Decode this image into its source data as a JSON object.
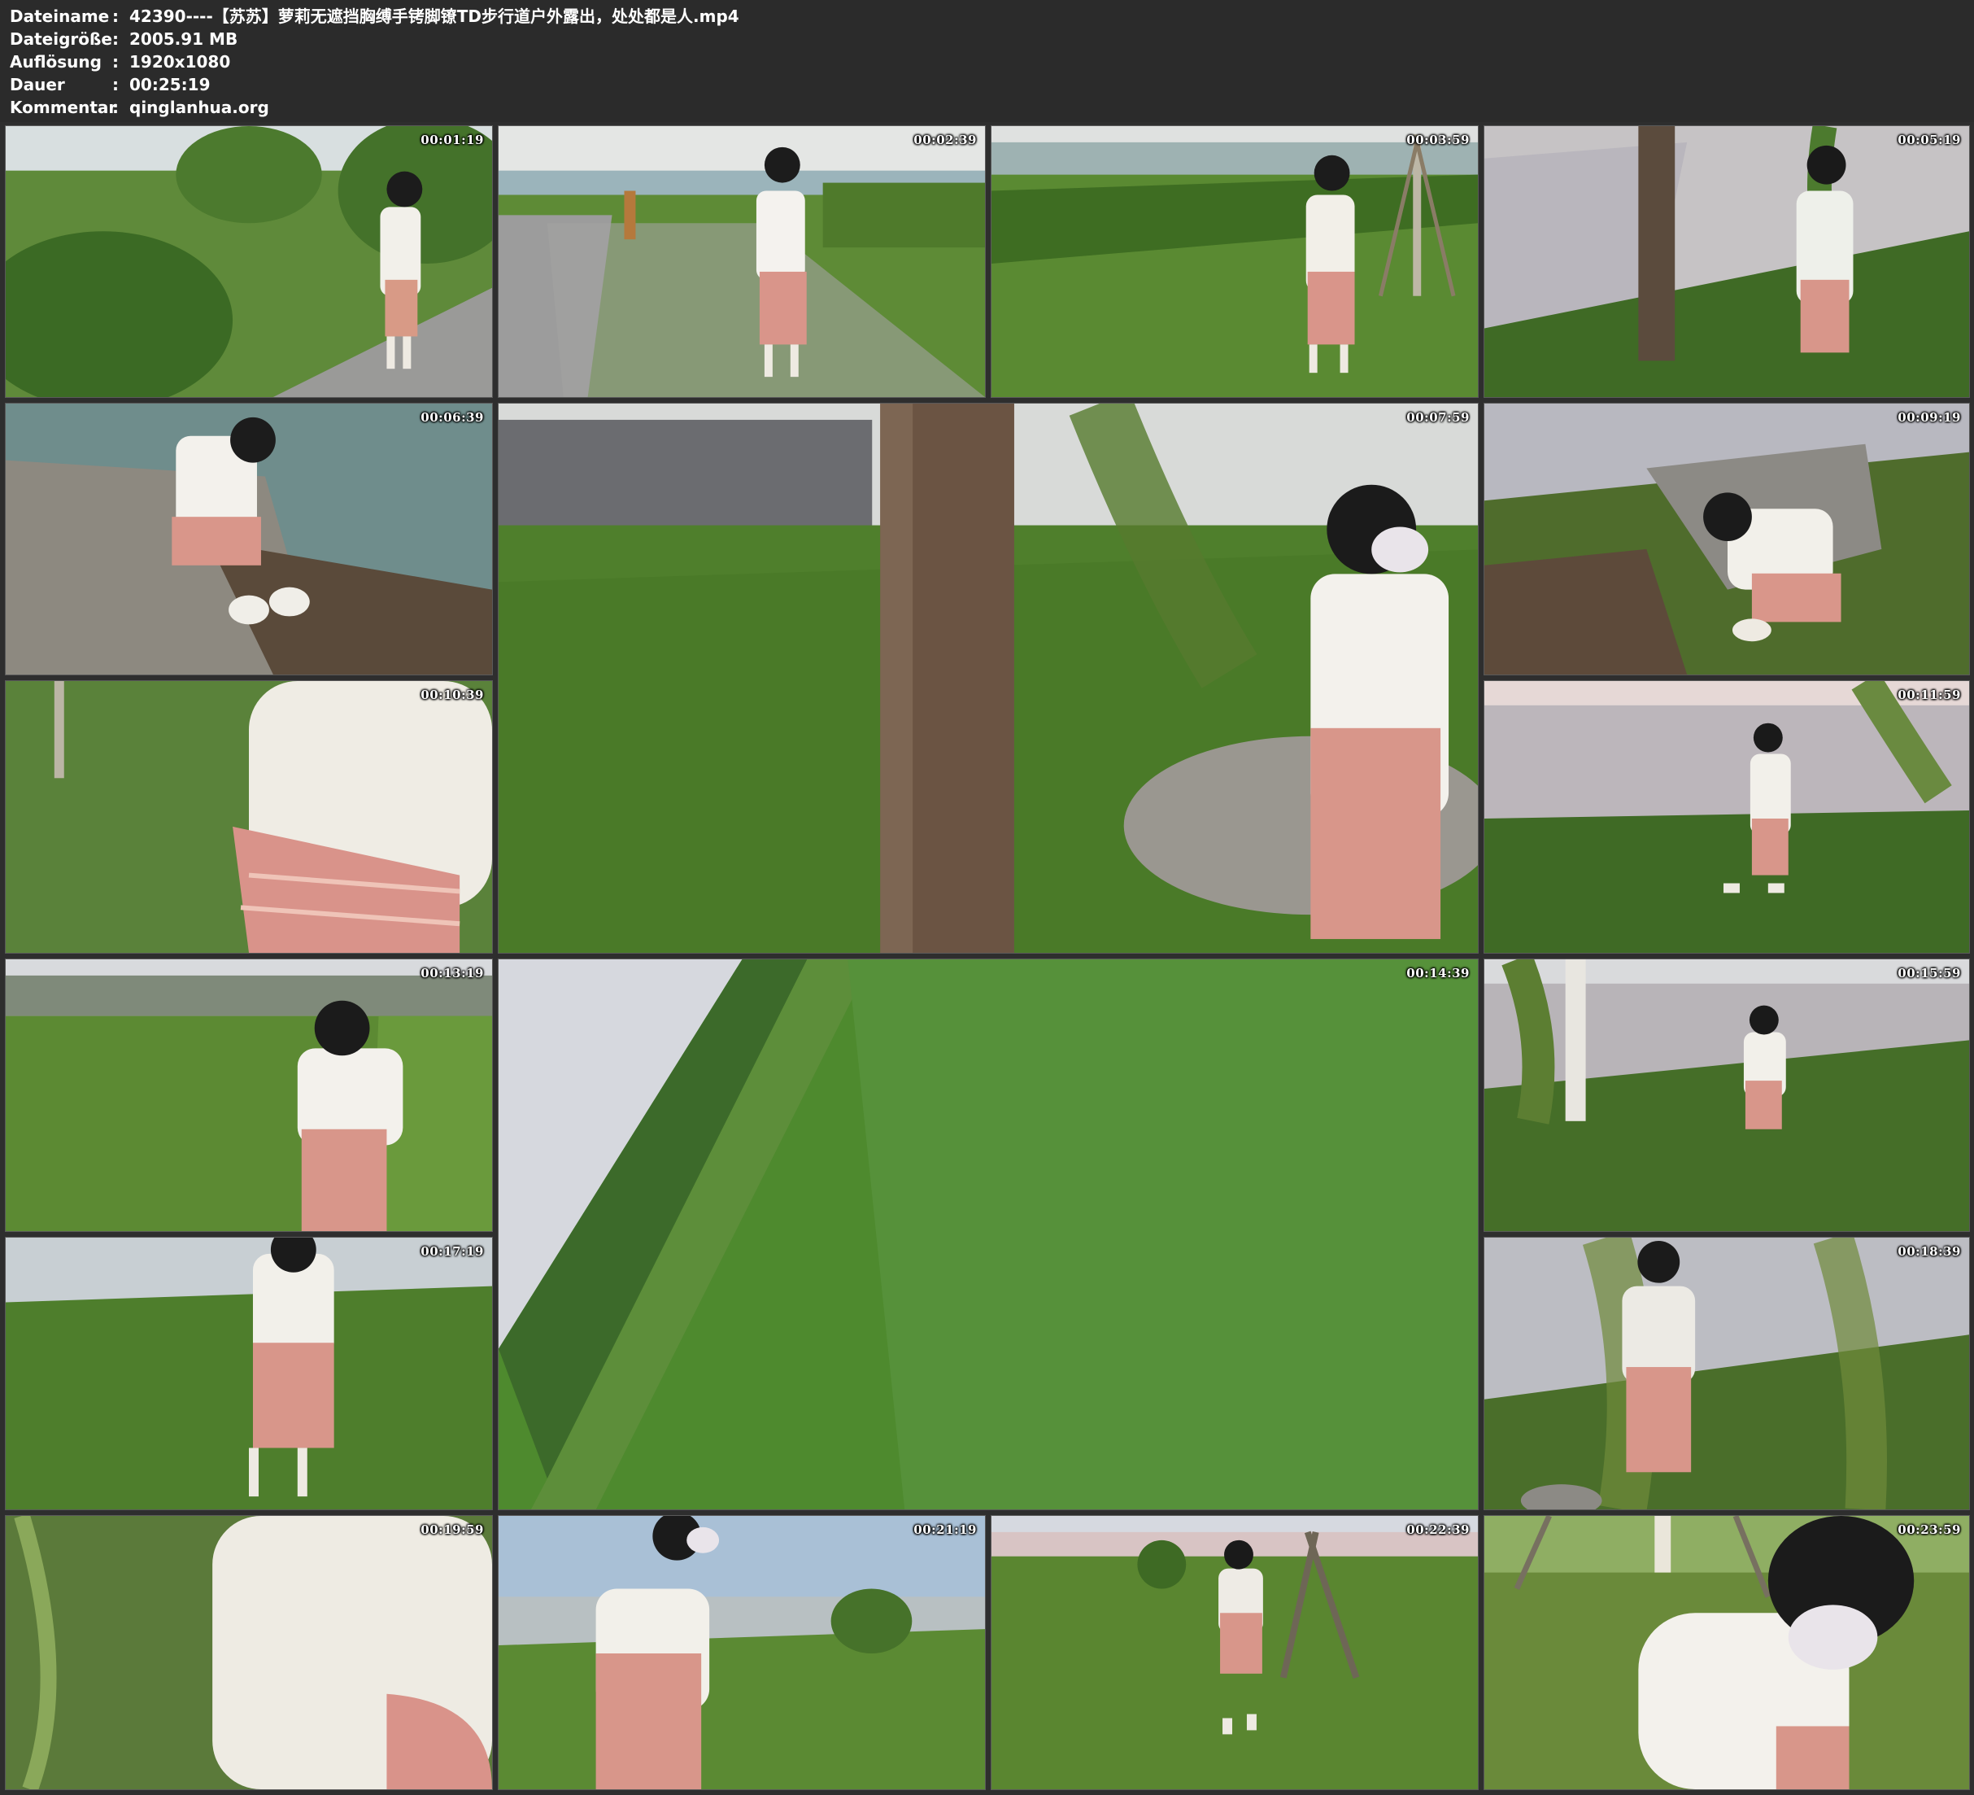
{
  "metadata": [
    {
      "key": "Dateiname",
      "value": "42390----【苏苏】萝莉无遮挡胸缚手铐脚镣TD步行道户外露出，处处都是人.mp4"
    },
    {
      "key": "Dateigröße",
      "value": "2005.91 MB"
    },
    {
      "key": "Auflösung",
      "value": "1920x1080"
    },
    {
      "key": "Dauer",
      "value": "00:25:19"
    },
    {
      "key": "Kommentar",
      "value": "qinglanhua.org"
    }
  ],
  "separator": ":",
  "thumbnails": [
    {
      "timestamp": "00:01:19",
      "scene": "park-path-shrubs"
    },
    {
      "timestamp": "00:02:39",
      "scene": "paved-walkway"
    },
    {
      "timestamp": "00:03:59",
      "scene": "lawn-with-trees"
    },
    {
      "timestamp": "00:05:19",
      "scene": "lakeside-tree"
    },
    {
      "timestamp": "00:06:39",
      "scene": "rock-by-water"
    },
    {
      "timestamp": "00:07:59",
      "scene": "tree-trunk-lawn"
    },
    {
      "timestamp": "00:09:19",
      "scene": "crouching-by-rock"
    },
    {
      "timestamp": "00:10:39",
      "scene": "closeup-back"
    },
    {
      "timestamp": "00:11:59",
      "scene": "lakeshore-walk"
    },
    {
      "timestamp": "00:13:19",
      "scene": "field-back-view"
    },
    {
      "timestamp": "00:14:39",
      "scene": "tilted-grass-slope"
    },
    {
      "timestamp": "00:15:59",
      "scene": "lakeside-willow"
    },
    {
      "timestamp": "00:17:19",
      "scene": "grass-by-lake"
    },
    {
      "timestamp": "00:18:39",
      "scene": "willow-branches"
    },
    {
      "timestamp": "00:19:59",
      "scene": "closeup-sweater"
    },
    {
      "timestamp": "00:21:19",
      "scene": "park-trees-sky"
    },
    {
      "timestamp": "00:22:39",
      "scene": "sunset-lawn"
    },
    {
      "timestamp": "00:23:59",
      "scene": "closeup-face-mask"
    }
  ]
}
